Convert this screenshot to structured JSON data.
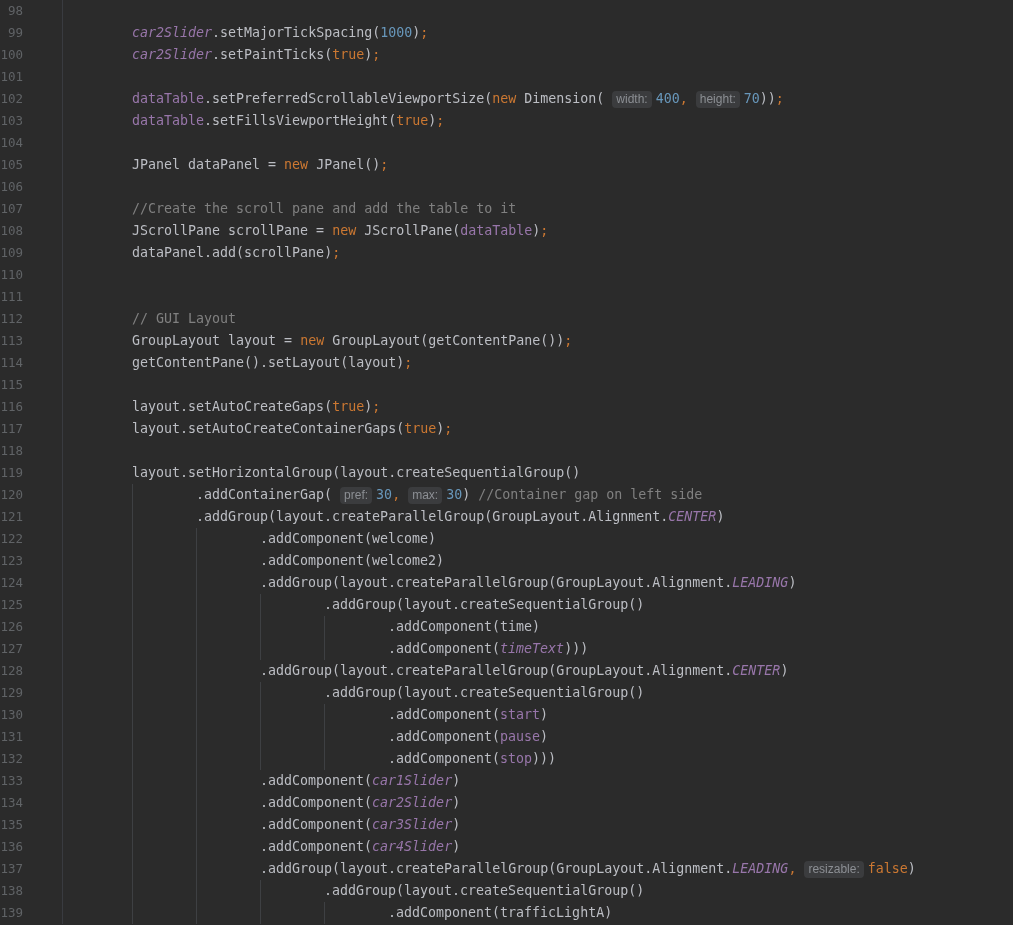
{
  "editor": {
    "lines": [
      {
        "number": "98"
      },
      {
        "number": "99",
        "tokens": [
          {
            "kind": "static",
            "text": "car2Slider"
          },
          {
            "kind": "plain",
            "text": ".setMajorTickSpacing("
          },
          {
            "kind": "number",
            "text": "1000"
          },
          {
            "kind": "plain",
            "text": ")"
          },
          {
            "kind": "keyword",
            "text": ";"
          }
        ]
      },
      {
        "number": "100",
        "tokens": [
          {
            "kind": "static",
            "text": "car2Slider"
          },
          {
            "kind": "plain",
            "text": ".setPaintTicks("
          },
          {
            "kind": "keyword",
            "text": "true"
          },
          {
            "kind": "plain",
            "text": ")"
          },
          {
            "kind": "keyword",
            "text": ";"
          }
        ]
      },
      {
        "number": "101"
      },
      {
        "number": "102",
        "tokens": [
          {
            "kind": "field",
            "text": "dataTable"
          },
          {
            "kind": "plain",
            "text": ".setPreferredScrollableViewportSize("
          },
          {
            "kind": "keyword",
            "text": "new"
          },
          {
            "kind": "plain",
            "text": " Dimension("
          },
          {
            "kind": "hint",
            "text": "width:"
          },
          {
            "kind": "number",
            "text": "400"
          },
          {
            "kind": "keyword",
            "text": ","
          },
          {
            "kind": "hint",
            "text": "height:"
          },
          {
            "kind": "number",
            "text": "70"
          },
          {
            "kind": "plain",
            "text": "))"
          },
          {
            "kind": "keyword",
            "text": ";"
          }
        ]
      },
      {
        "number": "103",
        "tokens": [
          {
            "kind": "field",
            "text": "dataTable"
          },
          {
            "kind": "plain",
            "text": ".setFillsViewportHeight("
          },
          {
            "kind": "keyword",
            "text": "true"
          },
          {
            "kind": "plain",
            "text": ")"
          },
          {
            "kind": "keyword",
            "text": ";"
          }
        ]
      },
      {
        "number": "104"
      },
      {
        "number": "105",
        "tokens": [
          {
            "kind": "plain",
            "text": "JPanel dataPanel = "
          },
          {
            "kind": "keyword",
            "text": "new"
          },
          {
            "kind": "plain",
            "text": " JPanel()"
          },
          {
            "kind": "keyword",
            "text": ";"
          }
        ]
      },
      {
        "number": "106"
      },
      {
        "number": "107",
        "tokens": [
          {
            "kind": "comment",
            "text": "//Create the scroll pane and add the table to it"
          }
        ]
      },
      {
        "number": "108",
        "tokens": [
          {
            "kind": "plain",
            "text": "JScrollPane scrollPane = "
          },
          {
            "kind": "keyword",
            "text": "new"
          },
          {
            "kind": "plain",
            "text": " JScrollPane("
          },
          {
            "kind": "field",
            "text": "dataTable"
          },
          {
            "kind": "plain",
            "text": ")"
          },
          {
            "kind": "keyword",
            "text": ";"
          }
        ]
      },
      {
        "number": "109",
        "tokens": [
          {
            "kind": "plain",
            "text": "dataPanel.add(scrollPane)"
          },
          {
            "kind": "keyword",
            "text": ";"
          }
        ]
      },
      {
        "number": "110"
      },
      {
        "number": "111"
      },
      {
        "number": "112",
        "tokens": [
          {
            "kind": "comment",
            "text": "// GUI Layout"
          }
        ]
      },
      {
        "number": "113",
        "tokens": [
          {
            "kind": "plain",
            "text": "GroupLayout layout = "
          },
          {
            "kind": "keyword",
            "text": "new"
          },
          {
            "kind": "plain",
            "text": " GroupLayout(getContentPane())"
          },
          {
            "kind": "keyword",
            "text": ";"
          }
        ]
      },
      {
        "number": "114",
        "tokens": [
          {
            "kind": "plain",
            "text": "getContentPane().setLayout(layout)"
          },
          {
            "kind": "keyword",
            "text": ";"
          }
        ]
      },
      {
        "number": "115"
      },
      {
        "number": "116",
        "tokens": [
          {
            "kind": "plain",
            "text": "layout.setAutoCreateGaps("
          },
          {
            "kind": "keyword",
            "text": "true"
          },
          {
            "kind": "plain",
            "text": ")"
          },
          {
            "kind": "keyword",
            "text": ";"
          }
        ]
      },
      {
        "number": "117",
        "tokens": [
          {
            "kind": "plain",
            "text": "layout.setAutoCreateContainerGaps("
          },
          {
            "kind": "keyword",
            "text": "true"
          },
          {
            "kind": "plain",
            "text": ")"
          },
          {
            "kind": "keyword",
            "text": ";"
          }
        ]
      },
      {
        "number": "118"
      },
      {
        "number": "119",
        "tokens": [
          {
            "kind": "plain",
            "text": "layout.setHorizontalGroup(layout.createSequentialGroup()"
          }
        ],
        "children": [
          {
            "number": "120",
            "tokens": [
              {
                "kind": "plain",
                "text": ".addContainerGap("
              },
              {
                "kind": "hint",
                "text": "pref:"
              },
              {
                "kind": "number",
                "text": "30"
              },
              {
                "kind": "keyword",
                "text": ","
              },
              {
                "kind": "hint",
                "text": "max:"
              },
              {
                "kind": "number",
                "text": "30"
              },
              {
                "kind": "plain",
                "text": ") "
              },
              {
                "kind": "comment",
                "text": "//Container gap on left side"
              }
            ]
          },
          {
            "number": "121",
            "tokens": [
              {
                "kind": "plain",
                "text": ".addGroup(layout.createParallelGroup(GroupLayout.Alignment."
              },
              {
                "kind": "static",
                "text": "CENTER"
              },
              {
                "kind": "plain",
                "text": ")"
              }
            ],
            "children": [
              {
                "number": "122",
                "tokens": [
                  {
                    "kind": "plain",
                    "text": ".addComponent(welcome)"
                  }
                ]
              },
              {
                "number": "123",
                "tokens": [
                  {
                    "kind": "plain",
                    "text": ".addComponent(welcome2)"
                  }
                ]
              },
              {
                "number": "124",
                "tokens": [
                  {
                    "kind": "plain",
                    "text": ".addGroup(layout.createParallelGroup(GroupLayout.Alignment."
                  },
                  {
                    "kind": "static",
                    "text": "LEADING"
                  },
                  {
                    "kind": "plain",
                    "text": ")"
                  }
                ],
                "children": [
                  {
                    "number": "125",
                    "tokens": [
                      {
                        "kind": "plain",
                        "text": ".addGroup(layout.createSequentialGroup()"
                      }
                    ],
                    "children": [
                      {
                        "number": "126",
                        "tokens": [
                          {
                            "kind": "plain",
                            "text": ".addComponent(time)"
                          }
                        ]
                      },
                      {
                        "number": "127",
                        "tokens": [
                          {
                            "kind": "plain",
                            "text": ".addComponent("
                          },
                          {
                            "kind": "static",
                            "text": "timeText"
                          },
                          {
                            "kind": "plain",
                            "text": ")))"
                          }
                        ]
                      }
                    ]
                  }
                ]
              },
              {
                "number": "128",
                "tokens": [
                  {
                    "kind": "plain",
                    "text": ".addGroup(layout.createParallelGroup(GroupLayout.Alignment."
                  },
                  {
                    "kind": "static",
                    "text": "CENTER"
                  },
                  {
                    "kind": "plain",
                    "text": ")"
                  }
                ],
                "children": [
                  {
                    "number": "129",
                    "tokens": [
                      {
                        "kind": "plain",
                        "text": ".addGroup(layout.createSequentialGroup()"
                      }
                    ],
                    "children": [
                      {
                        "number": "130",
                        "tokens": [
                          {
                            "kind": "plain",
                            "text": ".addComponent("
                          },
                          {
                            "kind": "field",
                            "text": "start"
                          },
                          {
                            "kind": "plain",
                            "text": ")"
                          }
                        ]
                      },
                      {
                        "number": "131",
                        "tokens": [
                          {
                            "kind": "plain",
                            "text": ".addComponent("
                          },
                          {
                            "kind": "field",
                            "text": "pause"
                          },
                          {
                            "kind": "plain",
                            "text": ")"
                          }
                        ]
                      },
                      {
                        "number": "132",
                        "tokens": [
                          {
                            "kind": "plain",
                            "text": ".addComponent("
                          },
                          {
                            "kind": "field",
                            "text": "stop"
                          },
                          {
                            "kind": "plain",
                            "text": ")))"
                          }
                        ]
                      }
                    ]
                  }
                ]
              },
              {
                "number": "133",
                "tokens": [
                  {
                    "kind": "plain",
                    "text": ".addComponent("
                  },
                  {
                    "kind": "static",
                    "text": "car1Slider"
                  },
                  {
                    "kind": "plain",
                    "text": ")"
                  }
                ]
              },
              {
                "number": "134",
                "tokens": [
                  {
                    "kind": "plain",
                    "text": ".addComponent("
                  },
                  {
                    "kind": "static",
                    "text": "car2Slider"
                  },
                  {
                    "kind": "plain",
                    "text": ")"
                  }
                ]
              },
              {
                "number": "135",
                "tokens": [
                  {
                    "kind": "plain",
                    "text": ".addComponent("
                  },
                  {
                    "kind": "static",
                    "text": "car3Slider"
                  },
                  {
                    "kind": "plain",
                    "text": ")"
                  }
                ]
              },
              {
                "number": "136",
                "tokens": [
                  {
                    "kind": "plain",
                    "text": ".addComponent("
                  },
                  {
                    "kind": "static",
                    "text": "car4Slider"
                  },
                  {
                    "kind": "plain",
                    "text": ")"
                  }
                ]
              },
              {
                "number": "137",
                "tokens": [
                  {
                    "kind": "plain",
                    "text": ".addGroup(layout.createParallelGroup(GroupLayout.Alignment."
                  },
                  {
                    "kind": "static",
                    "text": "LEADING"
                  },
                  {
                    "kind": "keyword",
                    "text": ","
                  },
                  {
                    "kind": "hint",
                    "text": "resizable:"
                  },
                  {
                    "kind": "keyword",
                    "text": "false"
                  },
                  {
                    "kind": "plain",
                    "text": ")"
                  }
                ],
                "children": [
                  {
                    "number": "138",
                    "tokens": [
                      {
                        "kind": "plain",
                        "text": ".addGroup(layout.createSequentialGroup()"
                      }
                    ],
                    "children": [
                      {
                        "number": "139",
                        "tokens": [
                          {
                            "kind": "plain",
                            "text": ".addComponent(trafficLightA)"
                          }
                        ]
                      }
                    ]
                  }
                ]
              }
            ]
          }
        ]
      }
    ]
  }
}
